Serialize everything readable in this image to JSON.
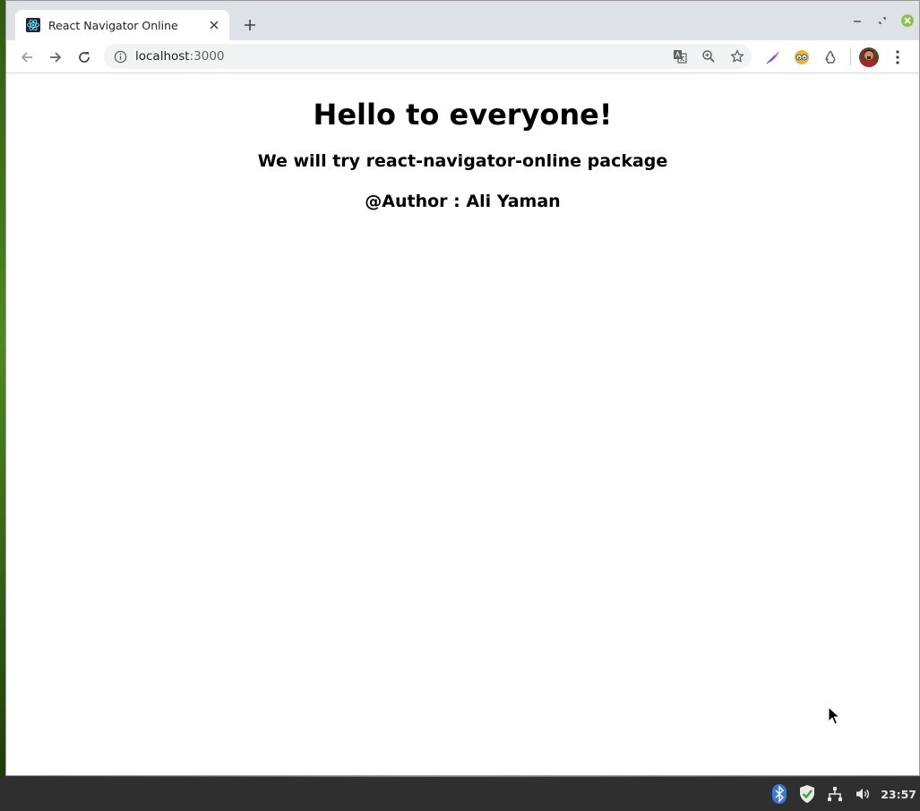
{
  "browser": {
    "tab": {
      "title": "React Navigator Online",
      "favicon": "react-icon"
    },
    "address_bar": {
      "host": "localhost",
      "port_suffix": ":3000"
    },
    "colors": {
      "react_blue": "#61dafb",
      "frame": "#dee1e6",
      "omnibox": "#f1f3f4"
    }
  },
  "page": {
    "heading": "Hello to everyone!",
    "subheading": "We will try react-navigator-online package",
    "author": "@Author : Ali Yaman"
  },
  "taskbar": {
    "clock": "23:57",
    "tray_icons": [
      "bluetooth-icon",
      "shield-check-icon",
      "network-icon",
      "volume-icon"
    ]
  }
}
